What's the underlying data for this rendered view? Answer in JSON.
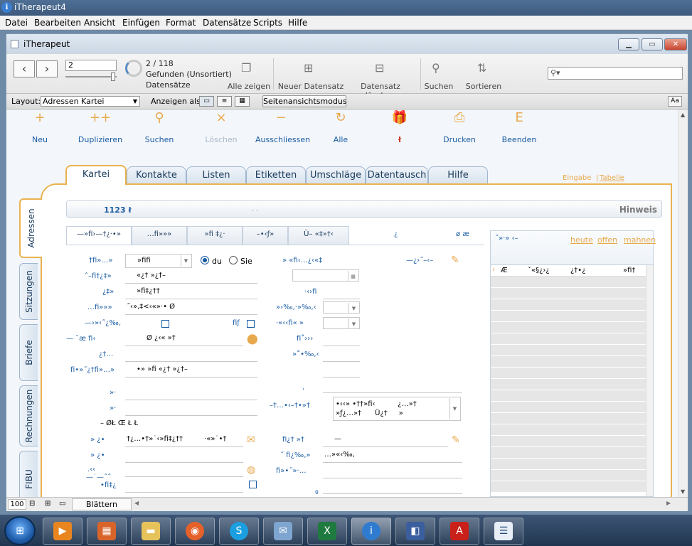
{
  "app_title": "iTherapeut4",
  "menu": [
    "Datei",
    "Bearbeiten",
    "Ansicht",
    "Einfügen",
    "Format",
    "Datensätze",
    "Scripts",
    "Hilfe"
  ],
  "window": {
    "title": "iTherapeut"
  },
  "toolbar": {
    "record_input": "2",
    "record_counter": "2 / 118",
    "found": "Gefunden (Unsortiert)",
    "records_label": "Datensätze",
    "show_all": "Alle zeigen",
    "new_record": "Neuer Datensatz",
    "delete_record": "Datensatz löschen",
    "search": "Suchen",
    "sort": "Sortieren",
    "search_placeholder": ""
  },
  "layoutbar": {
    "layout_label": "Layout:",
    "layout_value": "Adressen Kartei",
    "view_as_label": "Anzeigen als:",
    "page_view_button": "Seitenansichtsmodus",
    "aa": "Aa"
  },
  "actions": [
    {
      "icon": "+",
      "label": "Neu"
    },
    {
      "icon": "++",
      "label": "Duplizieren"
    },
    {
      "icon": "⚲",
      "label": "Suchen"
    },
    {
      "icon": "×",
      "label": "Löschen"
    },
    {
      "icon": "−",
      "label": "Ausschliessen"
    },
    {
      "icon": "↻",
      "label": "Alle"
    },
    {
      "icon": "🎁",
      "label": "ł"
    },
    {
      "icon": "⎙",
      "label": "Drucken"
    },
    {
      "icon": "E",
      "label": "Beenden"
    }
  ],
  "tabs": [
    "Kartei",
    "Kontakte",
    "Listen",
    "Etiketten",
    "Umschläge",
    "Datentausch",
    "Hilfe"
  ],
  "view_links": {
    "left": "Eingabe",
    "sep": "|",
    "right": "Tabelle"
  },
  "side_tabs": [
    "Adressen",
    "Sitzungen",
    "Briefe",
    "Rechnungen",
    "FIBU"
  ],
  "header": {
    "id": "1123 ł",
    "hint": "Hinweis",
    "dots": ". ."
  },
  "subtabs": [
    "—»fi›—†¿·•»",
    "…fi»»»",
    "»fi  ‡¿·",
    "–•‹ƒ»",
    "Ü–  «‡»†‹",
    "¿",
    "ø æ"
  ],
  "form": {
    "salutation_label": "†fi»…»",
    "salutation_value": "»fifi",
    "du": "du",
    "sie": "Sie",
    "title_label": "ˆ–fi†¿‡»",
    "title_value": "«¿†   »¿†–",
    "name_label": "¿‡»",
    "name_value": "»fi‡¿††",
    "firstname_label": "…fi»»»",
    "firstname_value": "˝‹»‚‡<‹«»·• Ø",
    "contact_label": "—›»‹˝¿‰‚",
    "contact_right": "fiƒ",
    "addr_label": "—  ˇæ   fi‹",
    "addr_value": "Ø     ¿‹«   »†",
    "zip_label": "¿†…",
    "street_label": "fi•»˝¿†fi»…»",
    "street_value": "•»    »fi    «¿†     »¿†–",
    "phone1_label": "»·",
    "phone2_label": "»·",
    "country_row": "–     ØŁ Œ        Ł        Ł",
    "email_label": "»    ¿•",
    "email_value": "†¿…•†»˙‹»fi‡¿††",
    "email_extra": "·«»˙•†",
    "www_label": "»    ¿•",
    "note_labels": [
      ".‹‹",
      "—˙—˝˝",
      "•fi‡¿"
    ],
    "r_label1": "»      «fi‹…¿‹«‡",
    "r_label1b": "—¿›˝–‹–",
    "r_label2": "·‹›fi",
    "r_label3": "»›‰‚·»‰‚‹",
    "r_label4": "·«‹‹fi«      »",
    "r_label5": "fi˚›››",
    "r_label6": "»˚•‰‚‹",
    "r_label7": "–†…•‹–†•»†",
    "r_value7": "•‹‹» •††»fi‹          ¿…»†\n»ƒ¿…»†      Ü¿†     »",
    "r_label8": "fi¿†      »†",
    "r_value8": "—",
    "r_label9": "˝       fi¿‰‚»",
    "r_value9": "…»«‹‰‚",
    "r_label10": "fi»•˝»·…",
    "small_dot": "ˌ",
    "small_o": "º"
  },
  "right_list": {
    "header_left": "˝»·»     ‹–",
    "links": [
      "heute",
      "offen",
      "mahnen"
    ],
    "first_row": [
      "Æ",
      "ˇ«§¿›¿",
      "¿†•¿",
      "»fi†"
    ]
  },
  "status": {
    "zoom": "100",
    "mode": "Blättern"
  },
  "taskbar": [
    "Media",
    "Tool",
    "Explorer",
    "Firefox",
    "Skype",
    "Mail",
    "Excel",
    "iTherapeut",
    "Presentation",
    "PDF",
    "Contacts"
  ]
}
